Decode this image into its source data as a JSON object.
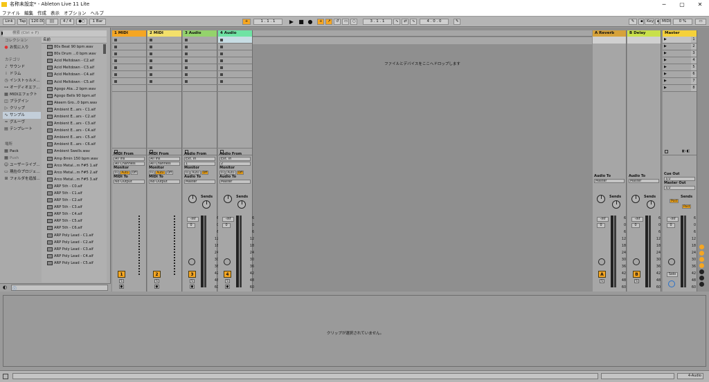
{
  "window": {
    "title": "名称未設定* - Ableton Live 11 Lite",
    "minimize": "─",
    "maximize": "▢",
    "close": "✕"
  },
  "menu": [
    "ファイル",
    "編集",
    "作成",
    "表示",
    "オプション",
    "ヘルプ"
  ],
  "transport": {
    "link": "Link",
    "tap": "Tap",
    "tempo": "120.00",
    "metro_icon": "||||",
    "time_sig": "4 / 4",
    "dot": "●○",
    "quantize": "1 Bar",
    "position": "1 .  1 .  1",
    "play": "▶",
    "stop": "■",
    "record": "●",
    "loop_start": "3 .  1 .  1",
    "loop_len": "4 .  0 .  0",
    "key": "Key",
    "midi": "MIDI",
    "cpu": "0 %"
  },
  "browser": {
    "search_placeholder": "検索 (Ctrl + F)",
    "collection_hdr": "コレクション",
    "favorites": "お気に入り",
    "category_hdr": "カテゴリ",
    "categories": [
      "サウンド",
      "ドラム",
      "インストゥルメ...",
      "オーディオエフ...",
      "MIDIエフェクト",
      "プラグイン",
      "クリップ",
      "サンプル",
      "グルーヴ",
      "テンプレート"
    ],
    "places_hdr": "場所",
    "places": [
      "Pack",
      "Push",
      "ユーザーライブ...",
      "現在のプロジェ...",
      "フォルダを追加..."
    ],
    "name_col": "名前",
    "files": [
      "80s Beat 90 bpm.wav",
      "80s Drum ...0 bpm.wav",
      "Acid Meltdown - C2.aif",
      "Acid Meltdown - C3.aif",
      "Acid Meltdown - C4.aif",
      "Acid Meltdown - C5.aif",
      "Agogo Ata...2 bpm.wav",
      "Agogo Bells 90 bpm.aif",
      "Akeem Gro...0 bpm.wav",
      "Ambient E...ars - C1.aif",
      "Ambient E...ars - C2.aif",
      "Ambient E...ars - C3.aif",
      "Ambient E...ars - C4.aif",
      "Ambient E...ars - C5.aif",
      "Ambient E...ars - C6.aif",
      "Ambient Swells.wav",
      "Amp 8min 150 bpm.wav",
      "Arco Metal...m F#5 1.aif",
      "Arco Metal...m F#5 2.aif",
      "Arco Metal...m F#5 3.aif",
      "ARP 5th - C0.aif",
      "ARP 5th - C1.aif",
      "ARP 5th - C2.aif",
      "ARP 5th - C3.aif",
      "ARP 5th - C4.aif",
      "ARP 5th - C5.aif",
      "ARP 5th - C6.aif",
      "ARP Poly Lead - C1.aif",
      "ARP Poly Lead - C2.aif",
      "ARP Poly Lead - C3.aif",
      "ARP Poly Lead - C4.aif",
      "ARP Poly Lead - C5.aif"
    ]
  },
  "tracks": [
    {
      "name": "1 MIDI",
      "color": "#f5a623",
      "num": "1",
      "io_from": "MIDI From",
      "from1": "All Ins",
      "from2": "All Channels",
      "monitor": "Monitor",
      "mon": [
        "In",
        "Auto",
        "Off"
      ],
      "io_to": "MIDI To",
      "to1": "No Output"
    },
    {
      "name": "2 MIDI",
      "color": "#f3e06b",
      "num": "2",
      "io_from": "MIDI From",
      "from1": "All Ins",
      "from2": "All Channels",
      "monitor": "Monitor",
      "mon": [
        "In",
        "Auto",
        "Off"
      ],
      "io_to": "MIDI To",
      "to1": "No Output"
    },
    {
      "name": "3 Audio",
      "color": "#94d36c",
      "num": "3",
      "io_from": "Audio From",
      "from1": "Ext. In",
      "from2": "1",
      "monitor": "Monitor",
      "mon": [
        "In",
        "Auto",
        "Off"
      ],
      "io_to": "Audio To",
      "to1": "Master",
      "vol": "-inf",
      "pan": "0",
      "sends": "Sends"
    },
    {
      "name": "4 Audio",
      "color": "#6fe3a4",
      "num": "4",
      "io_from": "Audio From",
      "from1": "Ext. In",
      "from2": "2",
      "monitor": "Monitor",
      "mon": [
        "In",
        "Auto",
        "Off"
      ],
      "io_to": "Audio To",
      "to1": "Master",
      "vol": "-inf",
      "pan": "0",
      "sends": "Sends"
    }
  ],
  "returns": [
    {
      "name": "A Reverb",
      "color": "#d6a23a",
      "num": "A",
      "io_to": "Audio To",
      "to1": "Master",
      "vol": "-inf",
      "pan": "0",
      "sends": "Sends"
    },
    {
      "name": "B Delay",
      "color": "#c8e04a",
      "num": "B",
      "io_to": "Audio To",
      "to1": "Master",
      "vol": "-inf",
      "pan": "0",
      "sends": "Sends"
    }
  ],
  "master": {
    "name": "Master",
    "color": "#f5d13a",
    "cue_out": "Cue Out",
    "cue_val": "1/2",
    "master_out": "Master Out",
    "master_val": "1/2",
    "sends": "Sends",
    "post": "Post",
    "vol": "-inf",
    "pan": "0",
    "solo": "Solo",
    "scenes": [
      "1",
      "2",
      "3",
      "4",
      "5",
      "6",
      "7",
      "8"
    ]
  },
  "scale": [
    "6",
    "0",
    "6",
    "12",
    "18",
    "24",
    "30",
    "36",
    "42",
    "48",
    "60"
  ],
  "drop_hint": "ファイルとデバイスをここへドロップします",
  "detail_hint": "クリップが選択されていません。",
  "status": {
    "track": "4-Audio"
  }
}
